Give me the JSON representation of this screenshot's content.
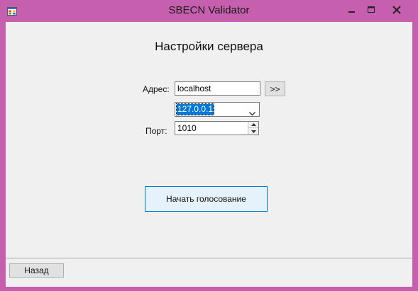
{
  "window": {
    "title": "SBECN Validator"
  },
  "main": {
    "heading": "Настройки сервера",
    "address_label": "Адрес:",
    "address_value": "localhost",
    "address_go_label": ">>",
    "ip_selected": "127.0.0.1",
    "port_label": "Порт:",
    "port_value": "1010",
    "start_vote_label": "Начать голосование"
  },
  "footer": {
    "back_label": "Назад"
  },
  "icons": {
    "app": "app-window-icon",
    "minimize": "minimize-icon",
    "maximize": "maximize-icon",
    "close": "close-icon",
    "dropdown": "chevron-down-icon",
    "spin_up": "triangle-up-icon",
    "spin_down": "triangle-down-icon"
  },
  "colors": {
    "frame": "#c65fae",
    "client": "#f0f0f0",
    "selection": "#0078d7",
    "accent_button_bg": "#e5f1fb"
  }
}
